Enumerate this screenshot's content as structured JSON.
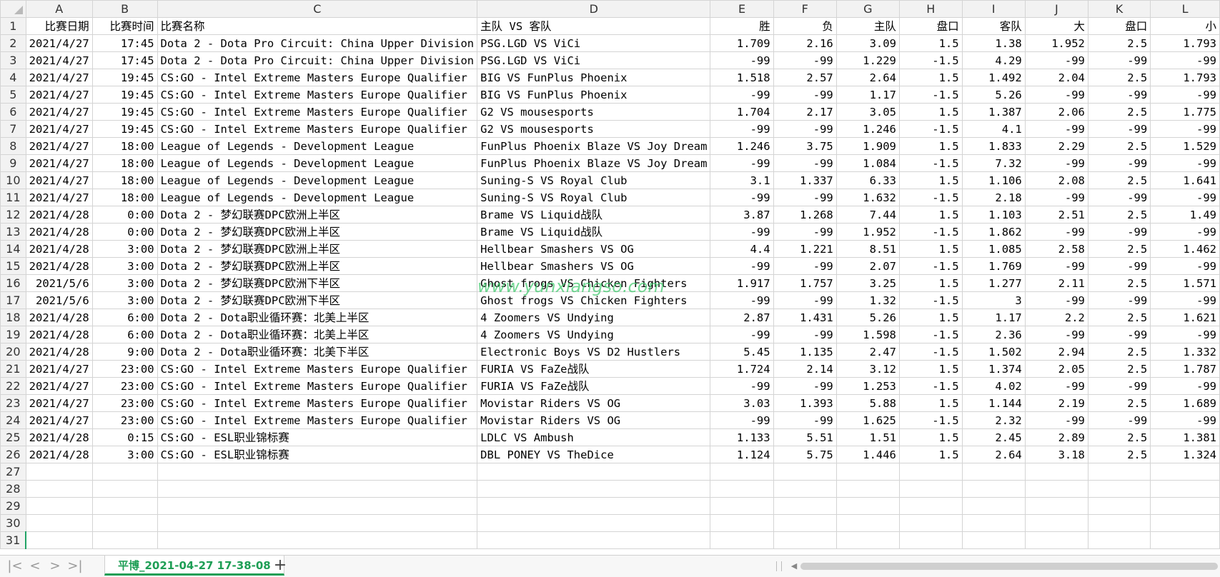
{
  "columns": [
    "A",
    "B",
    "C",
    "D",
    "E",
    "F",
    "G",
    "H",
    "I",
    "J",
    "K",
    "L"
  ],
  "header_row": [
    "比赛日期",
    "比赛时间",
    "比赛名称",
    "主队 VS 客队",
    "胜",
    "负",
    "主队",
    "盘口",
    "客队",
    "大",
    "盘口",
    "小"
  ],
  "rows": [
    [
      "2021/4/27",
      "17:45",
      "Dota 2 - Dota Pro Circuit: China Upper Division",
      "PSG.LGD VS ViCi",
      "1.709",
      "2.16",
      "3.09",
      "1.5",
      "1.38",
      "1.952",
      "2.5",
      "1.793"
    ],
    [
      "2021/4/27",
      "17:45",
      "Dota 2 - Dota Pro Circuit: China Upper Division",
      "PSG.LGD VS ViCi",
      "-99",
      "-99",
      "1.229",
      "-1.5",
      "4.29",
      "-99",
      "-99",
      "-99"
    ],
    [
      "2021/4/27",
      "19:45",
      "CS:GO - Intel Extreme Masters Europe Qualifier",
      "BIG VS FunPlus Phoenix",
      "1.518",
      "2.57",
      "2.64",
      "1.5",
      "1.492",
      "2.04",
      "2.5",
      "1.793"
    ],
    [
      "2021/4/27",
      "19:45",
      "CS:GO - Intel Extreme Masters Europe Qualifier",
      "BIG VS FunPlus Phoenix",
      "-99",
      "-99",
      "1.17",
      "-1.5",
      "5.26",
      "-99",
      "-99",
      "-99"
    ],
    [
      "2021/4/27",
      "19:45",
      "CS:GO - Intel Extreme Masters Europe Qualifier",
      "G2 VS mousesports",
      "1.704",
      "2.17",
      "3.05",
      "1.5",
      "1.387",
      "2.06",
      "2.5",
      "1.775"
    ],
    [
      "2021/4/27",
      "19:45",
      "CS:GO - Intel Extreme Masters Europe Qualifier",
      "G2 VS mousesports",
      "-99",
      "-99",
      "1.246",
      "-1.5",
      "4.1",
      "-99",
      "-99",
      "-99"
    ],
    [
      "2021/4/27",
      "18:00",
      "League of Legends - Development League",
      "FunPlus Phoenix Blaze VS Joy Dream",
      "1.246",
      "3.75",
      "1.909",
      "1.5",
      "1.833",
      "2.29",
      "2.5",
      "1.529"
    ],
    [
      "2021/4/27",
      "18:00",
      "League of Legends - Development League",
      "FunPlus Phoenix Blaze VS Joy Dream",
      "-99",
      "-99",
      "1.084",
      "-1.5",
      "7.32",
      "-99",
      "-99",
      "-99"
    ],
    [
      "2021/4/27",
      "18:00",
      "League of Legends - Development League",
      "Suning-S VS Royal Club",
      "3.1",
      "1.337",
      "6.33",
      "1.5",
      "1.106",
      "2.08",
      "2.5",
      "1.641"
    ],
    [
      "2021/4/27",
      "18:00",
      "League of Legends - Development League",
      "Suning-S VS Royal Club",
      "-99",
      "-99",
      "1.632",
      "-1.5",
      "2.18",
      "-99",
      "-99",
      "-99"
    ],
    [
      "2021/4/28",
      "0:00",
      "Dota 2 - 梦幻联赛DPC欧洲上半区",
      "Brame VS Liquid战队",
      "3.87",
      "1.268",
      "7.44",
      "1.5",
      "1.103",
      "2.51",
      "2.5",
      "1.49"
    ],
    [
      "2021/4/28",
      "0:00",
      "Dota 2 - 梦幻联赛DPC欧洲上半区",
      "Brame VS Liquid战队",
      "-99",
      "-99",
      "1.952",
      "-1.5",
      "1.862",
      "-99",
      "-99",
      "-99"
    ],
    [
      "2021/4/28",
      "3:00",
      "Dota 2 - 梦幻联赛DPC欧洲上半区",
      "Hellbear Smashers VS OG",
      "4.4",
      "1.221",
      "8.51",
      "1.5",
      "1.085",
      "2.58",
      "2.5",
      "1.462"
    ],
    [
      "2021/4/28",
      "3:00",
      "Dota 2 - 梦幻联赛DPC欧洲上半区",
      "Hellbear Smashers VS OG",
      "-99",
      "-99",
      "2.07",
      "-1.5",
      "1.769",
      "-99",
      "-99",
      "-99"
    ],
    [
      "2021/5/6",
      "3:00",
      "Dota 2 - 梦幻联赛DPC欧洲下半区",
      "Ghost frogs VS Chicken Fighters",
      "1.917",
      "1.757",
      "3.25",
      "1.5",
      "1.277",
      "2.11",
      "2.5",
      "1.571"
    ],
    [
      "2021/5/6",
      "3:00",
      "Dota 2 - 梦幻联赛DPC欧洲下半区",
      "Ghost frogs VS Chicken Fighters",
      "-99",
      "-99",
      "1.32",
      "-1.5",
      "3",
      "-99",
      "-99",
      "-99"
    ],
    [
      "2021/4/28",
      "6:00",
      "Dota 2 - Dota职业循环赛：北美上半区",
      "4 Zoomers VS Undying",
      "2.87",
      "1.431",
      "5.26",
      "1.5",
      "1.17",
      "2.2",
      "2.5",
      "1.621"
    ],
    [
      "2021/4/28",
      "6:00",
      "Dota 2 - Dota职业循环赛：北美上半区",
      "4 Zoomers VS Undying",
      "-99",
      "-99",
      "1.598",
      "-1.5",
      "2.36",
      "-99",
      "-99",
      "-99"
    ],
    [
      "2021/4/28",
      "9:00",
      "Dota 2 - Dota职业循环赛：北美下半区",
      "Electronic Boys VS D2 Hustlers",
      "5.45",
      "1.135",
      "2.47",
      "-1.5",
      "1.502",
      "2.94",
      "2.5",
      "1.332"
    ],
    [
      "2021/4/27",
      "23:00",
      "CS:GO - Intel Extreme Masters Europe Qualifier",
      "FURIA VS FaZe战队",
      "1.724",
      "2.14",
      "3.12",
      "1.5",
      "1.374",
      "2.05",
      "2.5",
      "1.787"
    ],
    [
      "2021/4/27",
      "23:00",
      "CS:GO - Intel Extreme Masters Europe Qualifier",
      "FURIA VS FaZe战队",
      "-99",
      "-99",
      "1.253",
      "-1.5",
      "4.02",
      "-99",
      "-99",
      "-99"
    ],
    [
      "2021/4/27",
      "23:00",
      "CS:GO - Intel Extreme Masters Europe Qualifier",
      "Movistar Riders VS OG",
      "3.03",
      "1.393",
      "5.88",
      "1.5",
      "1.144",
      "2.19",
      "2.5",
      "1.689"
    ],
    [
      "2021/4/27",
      "23:00",
      "CS:GO - Intel Extreme Masters Europe Qualifier",
      "Movistar Riders VS OG",
      "-99",
      "-99",
      "1.625",
      "-1.5",
      "2.32",
      "-99",
      "-99",
      "-99"
    ],
    [
      "2021/4/28",
      "0:15",
      "CS:GO - ESL职业锦标赛",
      "LDLC VS Ambush",
      "1.133",
      "5.51",
      "1.51",
      "1.5",
      "2.45",
      "2.89",
      "2.5",
      "1.381"
    ],
    [
      "2021/4/28",
      "3:00",
      "CS:GO - ESL职业锦标赛",
      "DBL PONEY VS TheDice",
      "1.124",
      "5.75",
      "1.446",
      "1.5",
      "2.64",
      "3.18",
      "2.5",
      "1.324"
    ]
  ],
  "empty_row_numbers": [
    "27",
    "28",
    "29",
    "30",
    "31"
  ],
  "active_row": "31",
  "watermark": "www.yunxiangso.com",
  "sheet_tab": "平博_2021-04-27 17-38-08",
  "tabbar": {
    "first_icon": "|<",
    "prev_icon": "<",
    "next_icon": ">",
    "last_icon": ">|",
    "add_icon": "+"
  },
  "colors": {
    "accent": "#1e9e55",
    "header_bg": "#f2f2f2",
    "gridline": "#d4d4d4",
    "watermark": "#3ec96b"
  }
}
